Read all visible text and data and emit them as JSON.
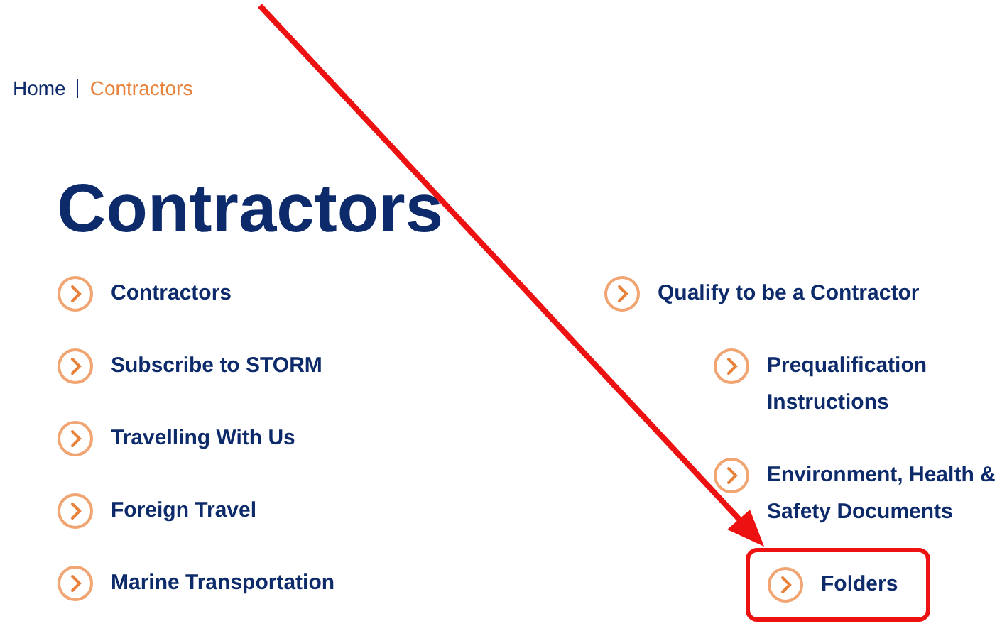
{
  "breadcrumb": [
    {
      "label": "Home",
      "selected": false
    },
    {
      "label": "Contractors",
      "selected": true
    }
  ],
  "title": "Contractors",
  "left_links": [
    {
      "label": "Contractors"
    },
    {
      "label": "Subscribe to STORM"
    },
    {
      "label": "Travelling With Us"
    },
    {
      "label": "Foreign Travel"
    },
    {
      "label": "Marine Transportation"
    }
  ],
  "right_links": [
    {
      "label": "Qualify to be a Contractor",
      "highlighted": false,
      "children": [
        {
          "label": "Prequalification Instructions",
          "highlighted": false
        },
        {
          "label": "Environment, Health & Safety Documents",
          "highlighted": false,
          "children": [
            {
              "label": "Folders",
              "highlighted": true
            }
          ]
        }
      ]
    }
  ]
}
